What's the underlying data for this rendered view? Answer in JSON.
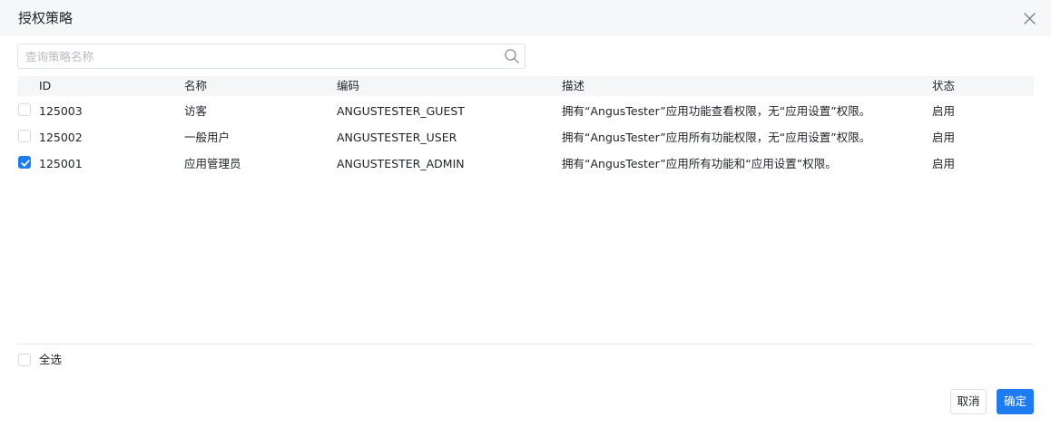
{
  "dialog": {
    "title": "授权策略",
    "close_icon": "close-icon"
  },
  "search": {
    "value": "",
    "placeholder": "查询策略名称",
    "icon": "search-icon"
  },
  "table": {
    "columns": [
      "ID",
      "名称",
      "编码",
      "描述",
      "状态"
    ],
    "rows": [
      {
        "checked": false,
        "id": "125003",
        "name": "访客",
        "code": "ANGUSTESTER_GUEST",
        "description": "拥有“AngusTester”应用功能查看权限，无“应用设置”权限。",
        "status": "启用"
      },
      {
        "checked": false,
        "id": "125002",
        "name": "一般用户",
        "code": "ANGUSTESTER_USER",
        "description": "拥有“AngusTester”应用所有功能权限，无“应用设置”权限。",
        "status": "启用"
      },
      {
        "checked": true,
        "id": "125001",
        "name": "应用管理员",
        "code": "ANGUSTESTER_ADMIN",
        "description": "拥有“AngusTester”应用所有功能和“应用设置”权限。",
        "status": "启用"
      }
    ]
  },
  "footer": {
    "select_all_label": "全选",
    "select_all_checked": false,
    "cancel_label": "取消",
    "ok_label": "确定"
  },
  "colors": {
    "primary": "#1e7cf0",
    "header_bg": "#f6f7f9",
    "table_header_bg": "#f5f6f8"
  }
}
